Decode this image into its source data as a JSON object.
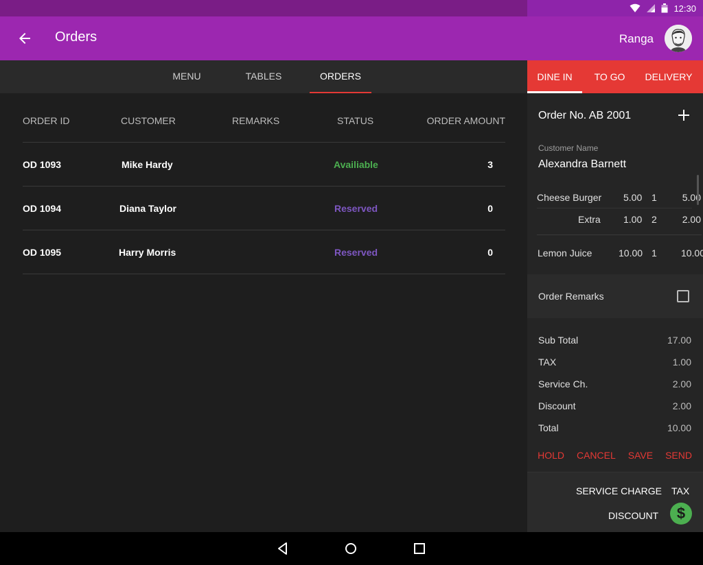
{
  "status_bar": {
    "time": "12:30",
    "icons": [
      "wifi-icon",
      "signal-icon",
      "battery-icon"
    ]
  },
  "app_bar": {
    "title": "Orders",
    "back_icon": "arrow-back-icon"
  },
  "tabs": [
    {
      "label": "MENU"
    },
    {
      "label": "TABLES"
    },
    {
      "label": "ORDERS",
      "active": true
    }
  ],
  "table": {
    "headers": [
      "ORDER ID",
      "CUSTOMER",
      "REMARKS",
      "STATUS",
      "ORDER AMOUNT"
    ],
    "rows": [
      {
        "order_id": "OD 1093",
        "customer": "Mike Hardy",
        "remarks": "",
        "status": "Availiable",
        "amount": "3"
      },
      {
        "order_id": "OD 1094",
        "customer": "Diana Taylor",
        "remarks": "",
        "status": "Reserved",
        "amount": "0"
      },
      {
        "order_id": "OD 1095",
        "customer": "Harry Morris",
        "remarks": "",
        "status": "Reserved",
        "amount": "0"
      }
    ]
  },
  "panel": {
    "user_name": "Ranga",
    "order_tabs": [
      {
        "label": "DINE IN",
        "active": true
      },
      {
        "label": "TO GO"
      },
      {
        "label": "DELIVERY"
      }
    ],
    "order_no": "Order No. AB 2001",
    "customer_label": "Customer Name",
    "customer_name": "Alexandra Barnett",
    "items": [
      {
        "name": "Cheese Burger",
        "price": "5.00",
        "qty": "1",
        "total": "5.00"
      },
      {
        "name": "Extra",
        "price": "1.00",
        "qty": "2",
        "total": "2.00"
      },
      {
        "name": "Lemon Juice",
        "price": "10.00",
        "qty": "1",
        "total": "10.00"
      }
    ],
    "order_remarks_label": "Order Remarks",
    "totals": [
      {
        "label": "Sub Total",
        "value": "17.00"
      },
      {
        "label": "TAX",
        "value": "1.00"
      },
      {
        "label": "Service Ch.",
        "value": "2.00"
      },
      {
        "label": "Discount",
        "value": "2.00"
      },
      {
        "label": "Total",
        "value": "10.00"
      }
    ],
    "actions": [
      "HOLD",
      "CANCEL",
      "SAVE",
      "SEND"
    ],
    "footer": {
      "service_charge": "SERVICE CHARGE",
      "tax": "TAX",
      "discount": "DISCOUNT",
      "dollar": "$"
    }
  },
  "colors": {
    "primary": "#9c27b0",
    "status_bar": "#7a1d86",
    "accent": "#e53935",
    "available": "#4caf50",
    "reserved": "#7e57c2",
    "background": "#1e1e1e"
  }
}
